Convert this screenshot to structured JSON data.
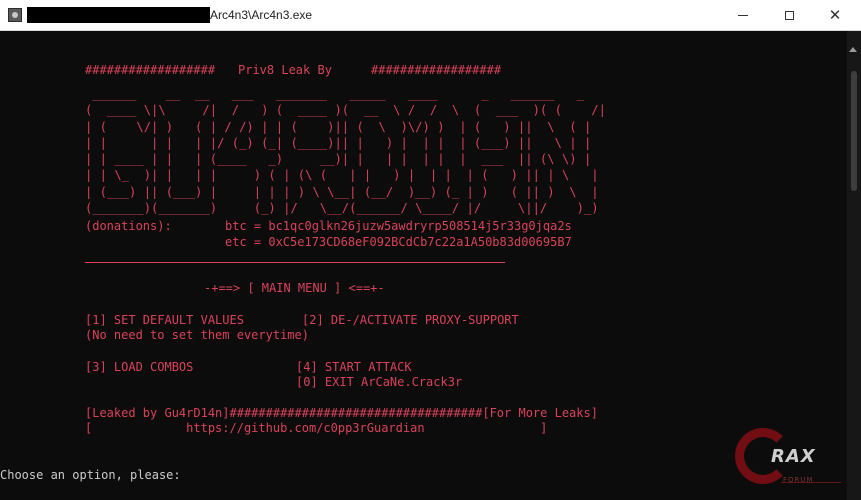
{
  "window": {
    "title": "Arc4n3\\Arc4n3.exe",
    "close_glyph": "✕"
  },
  "console": {
    "header_left": "##################",
    "header_center": "Priv8 Leak By",
    "header_right": "##################",
    "banner": [
      " ______    __  __   ___   _______   _____   ____      _   ______   _",
      "(  ____ \\|\\     /|  /   ) (  ____ )(  __  \\ /  /  \\  (  ___  )( (    /|",
      "| (    \\/| )   ( | / /) | | (    )|| (  \\  )\\/) )  | (   ) ||  \\  ( |",
      "| |      | |   | |/ (_) (_| (____)|| |   ) |  | |  | (___) ||   \\ | |",
      "| | ____ | |   | (____   _)     __)| |   | |  | |  |  ___  || (\\ \\) |",
      "| | \\_  )| |   | |     ) ( | (\\ (   | |   ) |  | |  | (   ) || | \\   |",
      "| (___) || (___) |     | | | ) \\ \\__| (__/  )__) (_ | )   ( || )  \\  |",
      "(_______)(_______)     (_) |/   \\__/(______/ \\____/ |/     \\||/    )_)"
    ],
    "donations_label": "(donations):",
    "btc": "btc = bc1qc0glkn26juzw5awdryrp508514j5r33g0jqa2s",
    "etc": "etc = 0xC5e173CD68eF092BCdCb7c22a1A50b83d00695B7",
    "menu_title": "-+==> [ MAIN MENU ] <==+-",
    "opt1": "[1] SET DEFAULT VALUES",
    "opt2": "[2] DE-/ACTIVATE PROXY-SUPPORT",
    "opt1_note": "(No need to set them everytime)",
    "opt3": "[3] LOAD COMBOS",
    "opt4": "[4] START ATTACK",
    "opt0": "[0] EXIT ArCaNe.Crack3r",
    "leak_line": "[Leaked by Gu4rD14n]###################################[For More Leaks]",
    "github_line": "[             https://github.com/c0pp3rGuardian                ]",
    "prompt": "Choose an option, please:"
  },
  "watermark": {
    "text": "RAX",
    "sub": "FORUM"
  },
  "colors": {
    "console_text": "#d8435b",
    "console_bg": "#0c0c0c",
    "prompt_text": "#cccccc"
  }
}
